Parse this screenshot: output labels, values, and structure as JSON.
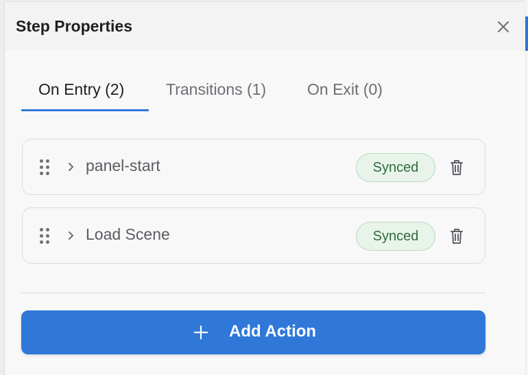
{
  "panel": {
    "title": "Step Properties",
    "close_icon": "close-icon"
  },
  "tabs": [
    {
      "label": "On Entry (2)",
      "active": true
    },
    {
      "label": "Transitions (1)",
      "active": false
    },
    {
      "label": "On Exit (0)",
      "active": false
    }
  ],
  "actions": [
    {
      "label": "panel-start",
      "status": "Synced",
      "icons": [
        "drag-handle-icon",
        "chevron-right-icon",
        "trash-icon"
      ]
    },
    {
      "label": "Load Scene",
      "status": "Synced",
      "icons": [
        "drag-handle-icon",
        "chevron-right-icon",
        "trash-icon"
      ]
    }
  ],
  "add_action": {
    "label": "Add Action",
    "icon": "plus-icon"
  },
  "colors": {
    "accent": "#2d78d8",
    "status_bg": "#e8f3ea",
    "status_text": "#2f6b3b"
  }
}
